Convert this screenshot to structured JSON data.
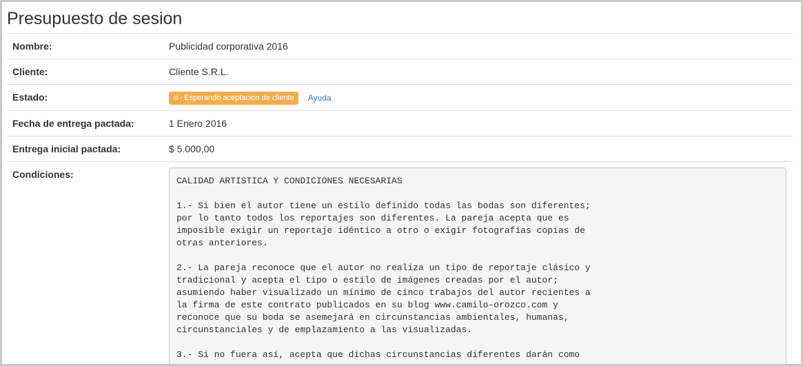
{
  "page": {
    "title": "Presupuesto de sesion"
  },
  "fields": {
    "nombre": {
      "label": "Nombre:",
      "value": "Publicidad corporativa 2016"
    },
    "cliente": {
      "label": "Cliente:",
      "value": "Cliente S.R.L."
    },
    "estado": {
      "label": "Estado:",
      "badge_icon": "clock-icon",
      "badge_glyph": "⊙",
      "badge_text": "· Esperando aceptacion de cliente",
      "badge_color": "#f0ad4e",
      "help_link": "Ayuda"
    },
    "fecha": {
      "label": "Fecha de entrega pactada:",
      "value": "1 Enero 2016"
    },
    "entrega": {
      "label": "Entrega inicial pactada:",
      "value": "$ 5.000,00"
    },
    "condiciones": {
      "label": "Condiciones:",
      "text": "CALIDAD ARTISTICA Y CONDICIONES NECESARIAS\n\n1.- Si bien el autor tiene un estilo definido todas las bodas son diferentes;\npor lo tanto todos los reportajes son diferentes. La pareja acepta que es\nimposible exigir un reportaje idéntico a otro o exigir fotografías copias de\notras anteriores.\n\n2.- La pareja reconoce que el autor no realiza un tipo de reportaje clásico y\ntradicional y acepta el tipo o estilo de imágenes creadas por el autor;\nasumiendo haber visualizado un mínimo de cinco trabajos del autor recientes a\nla firma de este contrato publicados en su blog www.camilo-orozco.com y\nreconoce que su boda se asemejará en circunstancias ambientales, humanas,\ncircunstanciales y de emplazamiento a las visualizadas.\n\n3.- Si no fuera así, acepta que dichas circunstancias diferentes darán como"
    }
  }
}
